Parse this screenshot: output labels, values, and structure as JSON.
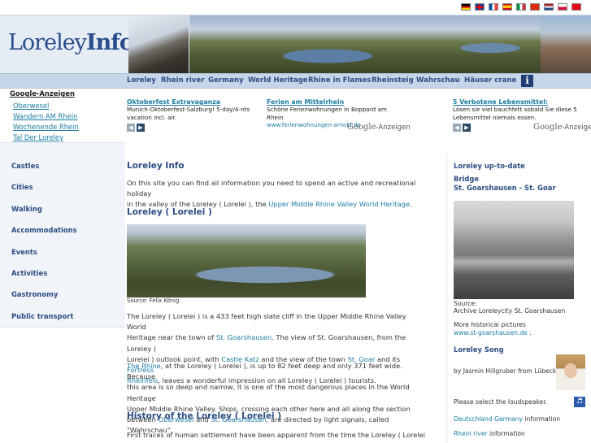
{
  "flags": [
    "de",
    "gb",
    "fr",
    "es",
    "it",
    "cn",
    "nl",
    "pl",
    "tr"
  ],
  "logo": {
    "part1": "Loreley",
    "part2": "Info"
  },
  "nav": [
    "Loreley",
    "Rhein river",
    "Germany",
    "World Heritage",
    "Rhine in Flames",
    "Rheinsteig",
    "Wahrschau",
    "Häuser crane"
  ],
  "left_ads": {
    "title": "Google-Anzeigen",
    "items": [
      "Oberwesel",
      "Wandern AM Rhein",
      "Wochenende Rhein",
      "Tal Der Loreley"
    ]
  },
  "top_ads": [
    {
      "title": "Oktoberfest Extravaganza",
      "desc": "Munich-Oktoberfest-Salzburg! 5-day/4-nts vacation incl. air.",
      "url": ""
    },
    {
      "title": "Ferien am Mittelrhein",
      "desc": "Schöne Ferienwohnungen in Boppard am Rhein",
      "url": "www.ferienwohnungen-arnold.de"
    },
    {
      "title": "5 Verbotene Lebensmittel:",
      "desc": "Lösen sie viel bauchfett sobald Sie diese 5 Lebensmittel niemals essen.",
      "url": ""
    }
  ],
  "google_ads_label": {
    "brand": "Google",
    "suffix": "-Anzeigen"
  },
  "left_menu": [
    "Castles",
    "Cities",
    "Walking",
    "Accommodations",
    "Events",
    "Activities",
    "Gastronomy",
    "Public transport"
  ],
  "main": {
    "title": "Loreley Info",
    "intro_1": "On this site you can find all information you need to spend an active and recreational holiday",
    "intro_2": "in the valley of the Loreley ( Lorelei ), the ",
    "intro_link": "Upper Middle Rhine Valley World Heritage",
    "intro_end": ".",
    "h2_loreley": "Loreley ( Lorelei )",
    "photo_caption": "Source: Felix König",
    "p1_l1": "The Loreley ( Lorelei ) is a 433 feet high slate cliff in the Upper Middle Rhine Valley World",
    "p1_l2a": "Heritage near the town of ",
    "p1_link1": "St. Goarshausen",
    "p1_l2b": ". The view of St. Goarshausen, from the Loreley (",
    "p1_l3a": "Lorelei ) outlook point, with ",
    "p1_link2": "Castle Katz",
    "p1_l3b": " and the view of the town ",
    "p1_link3": "St. Goar",
    "p1_l3c": " and its ",
    "p1_link4": "Fortress",
    "p1_link5": "Rheinfels",
    "p1_l4": ", leaves a wonderful impression on all Loreley ( Lorelei ) tourists.",
    "p2_link1": "The Rhine",
    "p2_l1": ", at the Loreley ( Lorelei ), is up to 82 feet deep and only 371 feet wide. Because",
    "p2_l2": "this area is so deep and narrow, it is one of the most dangerous places in the World Heritage",
    "p2_l3": "Upper Middle Rhine Valley. Ships, crossing each other here and all along the section",
    "p2_l4a": "between ",
    "p2_link2": "Oberwesel",
    "p2_l4b": " and ",
    "p2_link3": "St. Goarshausen",
    "p2_l4c": ", are directed by light signals, called \"Wahrschau\".",
    "h2_history": "History of the Loreley ( Lorelei )",
    "p3_l1": "First traces of human settlement have been apparent from the time the Loreley ( Lorelei )"
  },
  "right": {
    "title": "Loreley up-to-date",
    "bridge_title": "Bridge",
    "bridge_sub": "St. Goarshausen - St. Goar",
    "hist_caption_1": "Source:",
    "hist_caption_2": "Archive Loreleycity St. Goarshausen",
    "more_1": "More historical pictures",
    "more_link": "www.st-goarshausen.de",
    "more_end": " .",
    "song_title": "Loreley Song",
    "song_by": "by Jasmin Hillgruber from Lübeck.",
    "speaker_note": "Please select the loudspeaker.",
    "de_link": "Deutschland Germany",
    "de_suffix": " information",
    "rhein_link": "Rhein river",
    "rhein_suffix": " information"
  }
}
